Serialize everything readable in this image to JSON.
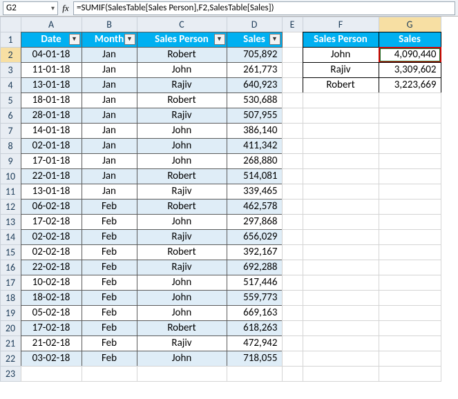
{
  "namebox": "G2",
  "fx_label": "fx",
  "formula": "=SUMIF(SalesTable[Sales Person],F2,SalesTable[Sales])",
  "columns": [
    "A",
    "B",
    "C",
    "D",
    "E",
    "F",
    "G"
  ],
  "row_count": 23,
  "selected_col": 7,
  "selected_row": 2,
  "table": {
    "headers": {
      "date": "Date",
      "month": "Month",
      "person": "Sales Person",
      "sales": "Sales"
    },
    "rows": [
      {
        "date": "04-01-18",
        "month": "Jan",
        "person": "Robert",
        "sales": "705,892"
      },
      {
        "date": "11-01-18",
        "month": "Jan",
        "person": "John",
        "sales": "261,773"
      },
      {
        "date": "13-01-18",
        "month": "Jan",
        "person": "Rajiv",
        "sales": "640,923"
      },
      {
        "date": "18-01-18",
        "month": "Jan",
        "person": "Robert",
        "sales": "530,688"
      },
      {
        "date": "28-01-18",
        "month": "Jan",
        "person": "Rajiv",
        "sales": "507,955"
      },
      {
        "date": "14-01-18",
        "month": "Jan",
        "person": "John",
        "sales": "386,140"
      },
      {
        "date": "02-01-18",
        "month": "Jan",
        "person": "John",
        "sales": "411,342"
      },
      {
        "date": "17-01-18",
        "month": "Jan",
        "person": "John",
        "sales": "268,880"
      },
      {
        "date": "22-01-18",
        "month": "Jan",
        "person": "Robert",
        "sales": "514,081"
      },
      {
        "date": "13-01-18",
        "month": "Jan",
        "person": "Rajiv",
        "sales": "339,465"
      },
      {
        "date": "06-02-18",
        "month": "Feb",
        "person": "Robert",
        "sales": "462,578"
      },
      {
        "date": "17-02-18",
        "month": "Feb",
        "person": "John",
        "sales": "297,868"
      },
      {
        "date": "02-02-18",
        "month": "Feb",
        "person": "Rajiv",
        "sales": "656,029"
      },
      {
        "date": "02-02-18",
        "month": "Feb",
        "person": "Robert",
        "sales": "392,167"
      },
      {
        "date": "22-02-18",
        "month": "Feb",
        "person": "Rajiv",
        "sales": "692,288"
      },
      {
        "date": "10-02-18",
        "month": "Feb",
        "person": "John",
        "sales": "517,446"
      },
      {
        "date": "18-02-18",
        "month": "Feb",
        "person": "John",
        "sales": "559,773"
      },
      {
        "date": "05-02-18",
        "month": "Feb",
        "person": "John",
        "sales": "669,163"
      },
      {
        "date": "17-02-18",
        "month": "Feb",
        "person": "Robert",
        "sales": "618,263"
      },
      {
        "date": "21-02-18",
        "month": "Feb",
        "person": "Rajiv",
        "sales": "472,942"
      },
      {
        "date": "03-02-18",
        "month": "Feb",
        "person": "John",
        "sales": "718,055"
      }
    ]
  },
  "summary": {
    "headers": {
      "person": "Sales Person",
      "sales": "Sales"
    },
    "rows": [
      {
        "person": "John",
        "sales": "4,090,440"
      },
      {
        "person": "Rajiv",
        "sales": "3,309,602"
      },
      {
        "person": "Robert",
        "sales": "3,223,669"
      }
    ]
  },
  "dropdown_glyph": "▼"
}
